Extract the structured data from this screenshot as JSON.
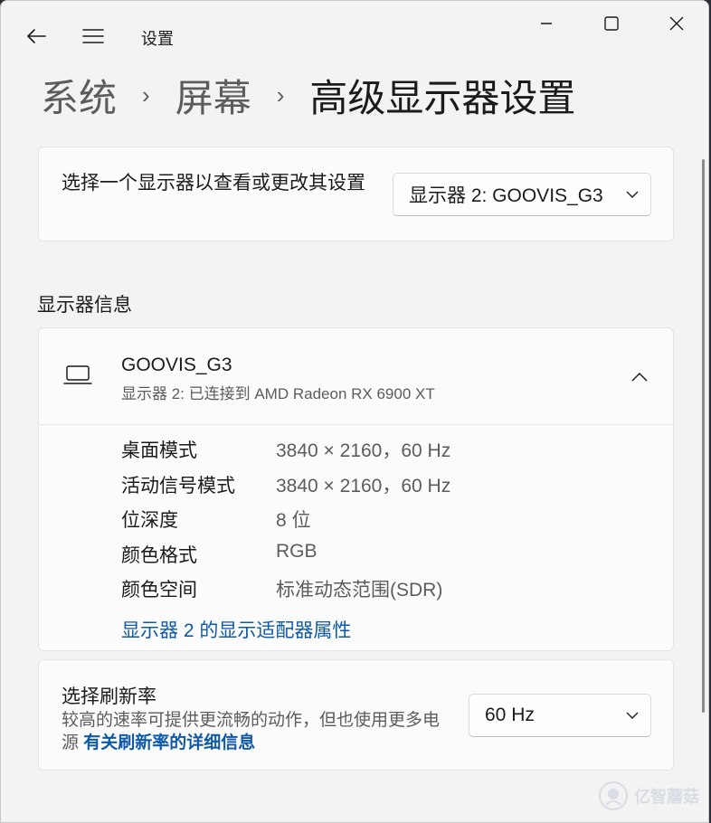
{
  "window": {
    "title": "设置",
    "icons": {
      "back": "arrow-left-icon",
      "menu": "hamburger-icon",
      "minimize": "minimize-icon",
      "maximize": "maximize-icon",
      "close": "close-icon"
    }
  },
  "breadcrumb": {
    "items": [
      "系统",
      "屏幕",
      "高级显示器设置"
    ],
    "separator": "›"
  },
  "monitor_select": {
    "label": "选择一个显示器以查看或更改其设置",
    "value": "显示器 2: GOOVIS_G3"
  },
  "section": {
    "heading": "显示器信息"
  },
  "display_info": {
    "name": "GOOVIS_G3",
    "subtitle": "显示器 2: 已连接到 AMD Radeon RX 6900 XT",
    "rows": [
      {
        "key": "桌面模式",
        "value": "3840 × 2160，60 Hz"
      },
      {
        "key": "活动信号模式",
        "value": "3840 × 2160，60 Hz"
      },
      {
        "key": "位深度",
        "value": "8 位"
      },
      {
        "key": "颜色格式",
        "value": "RGB"
      },
      {
        "key": "颜色空间",
        "value": "标准动态范围(SDR)"
      }
    ],
    "adapter_link": "显示器 2 的显示适配器属性"
  },
  "refresh": {
    "title": "选择刷新率",
    "description": "较高的速率可提供更流畅的动作，但也使用更多电源",
    "link": "有关刷新率的详细信息",
    "value": "60 Hz"
  },
  "watermark": {
    "text": "亿智蘑菇"
  },
  "colors": {
    "accent_link": "#0f5aa8",
    "background": "#f3f3f3",
    "card": "#fbfbfb"
  }
}
